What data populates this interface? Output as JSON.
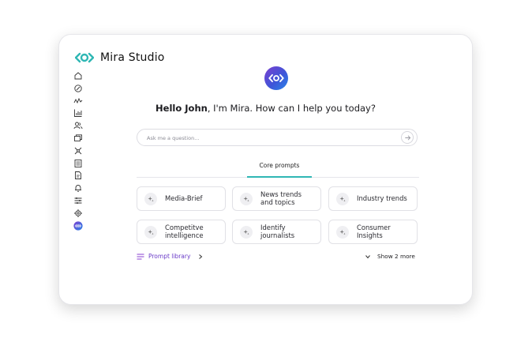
{
  "app": {
    "name": "Mira Studio"
  },
  "sidebar": {
    "items": [
      "home-icon",
      "explore-icon",
      "analytics-icon",
      "reports-icon",
      "people-icon",
      "media-icon",
      "network-icon",
      "documents-icon",
      "brief-icon",
      "notifications-icon",
      "settings-sliders-icon",
      "settings-gear-icon",
      "mira-icon"
    ]
  },
  "main": {
    "greeting_name": "Hello John",
    "greeting_rest": ", I'm Mira. How can I help you today?",
    "ask_placeholder": "Ask me a question...",
    "tab_label": "Core prompts",
    "prompts": [
      {
        "line1": "Media-Brief",
        "line2": ""
      },
      {
        "line1": "News trends",
        "line2": "and topics"
      },
      {
        "line1": "Industry trends",
        "line2": ""
      },
      {
        "line1": "Competitve",
        "line2": "intelligence"
      },
      {
        "line1": "Identify",
        "line2": "journalists"
      },
      {
        "line1": "Consumer",
        "line2": "Insights"
      }
    ],
    "library_label": "Prompt library",
    "show_more_label": "Show 2 more"
  },
  "colors": {
    "accent_teal": "#2fb7b4",
    "accent_purple": "#6a3bc8"
  }
}
